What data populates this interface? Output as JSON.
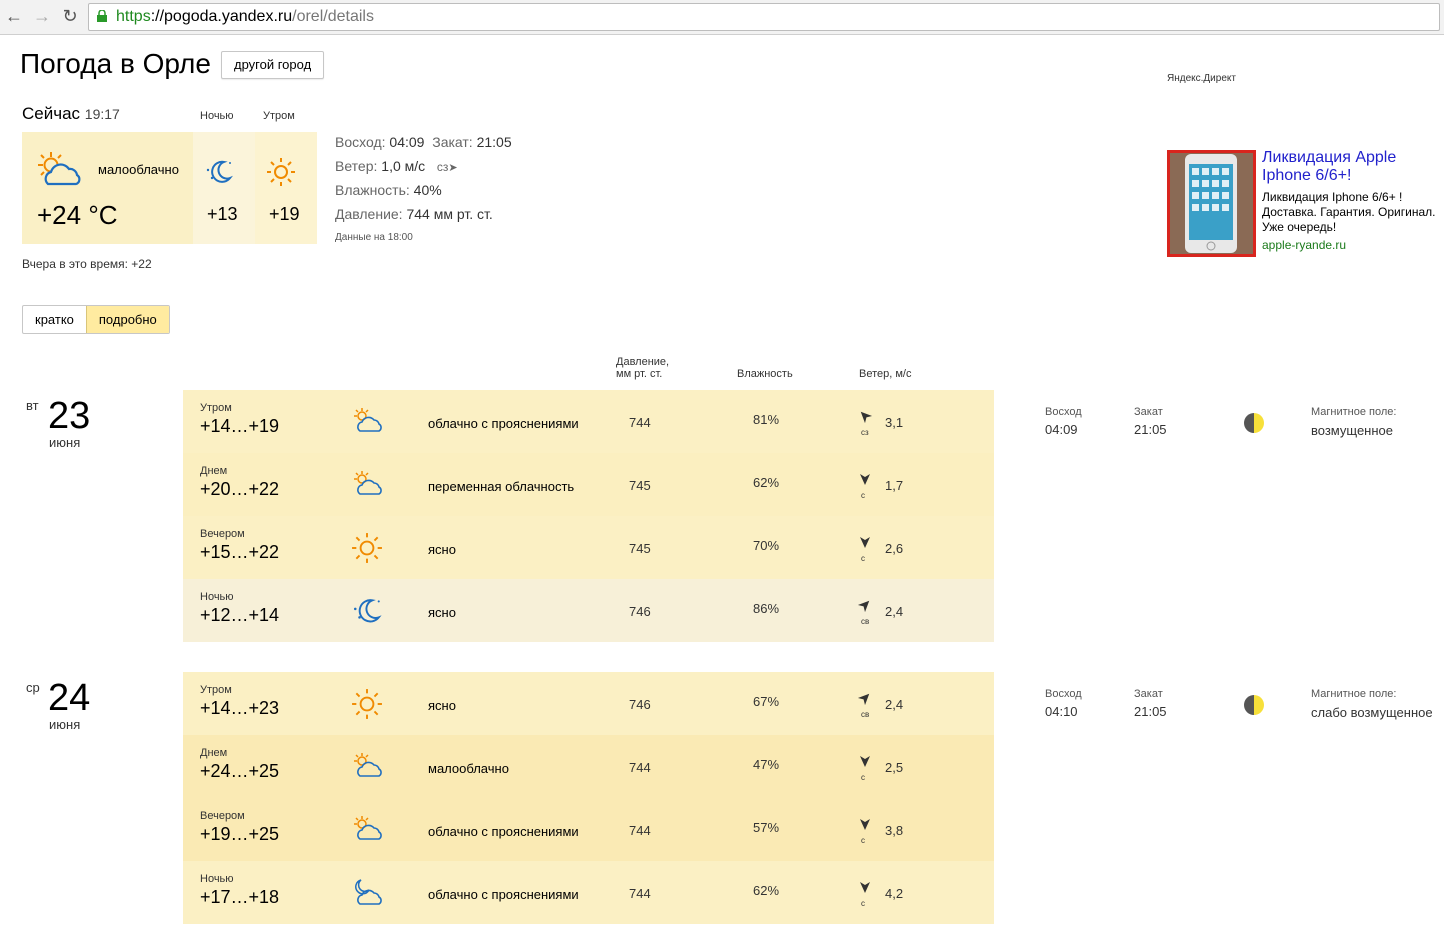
{
  "browser": {
    "url_scheme": "https",
    "url_host": "://pogoda.yandex.ru",
    "url_path": "/orel/details"
  },
  "header": {
    "title": "Погода в Орле",
    "other_city": "другой город"
  },
  "now": {
    "label": "Сейчас",
    "time": "19:17",
    "condition": "малооблачно",
    "temp": "+24 °C",
    "night_label": "Ночью",
    "night_temp": "+13",
    "morning_label": "Утром",
    "morning_temp": "+19",
    "yesterday": "Вчера в это время: +22"
  },
  "info": {
    "sunrise_label": "Восход:",
    "sunrise": "04:09",
    "sunset_label": "Закат:",
    "sunset": "21:05",
    "wind_label": "Ветер:",
    "wind": "1,0 м/с",
    "wind_dir": "сз",
    "humidity_label": "Влажность:",
    "humidity": "40%",
    "pressure_label": "Давление:",
    "pressure": "744 мм рт. ст.",
    "data_at": "Данные на 18:00"
  },
  "switch": {
    "brief": "кратко",
    "detailed": "подробно"
  },
  "columns": {
    "pressure1": "Давление,",
    "pressure2": "мм рт. ст.",
    "humidity": "Влажность",
    "wind": "Ветер, м/с"
  },
  "days": [
    {
      "dow": "вт",
      "num": "23",
      "month": "июня",
      "sunrise_label": "Восход",
      "sunrise": "04:09",
      "sunset_label": "Закат",
      "sunset": "21:05",
      "mag_label": "Магнитное поле:",
      "mag": "возмущенное",
      "rows": [
        {
          "part": "Утром",
          "temp": "+14…+19",
          "icon": "cloud-sun-icon",
          "cond": "облачно с прояснениями",
          "pres": "744",
          "hum": "81%",
          "wdir": "сз",
          "wind": "3,1",
          "bg": "#fbf0c4"
        },
        {
          "part": "Днем",
          "temp": "+20…+22",
          "icon": "cloud-sun-icon",
          "cond": "переменная облачность",
          "pres": "745",
          "hum": "62%",
          "wdir": "с",
          "wind": "1,7",
          "bg": "#fbefc0"
        },
        {
          "part": "Вечером",
          "temp": "+15…+22",
          "icon": "sun-icon",
          "cond": "ясно",
          "pres": "745",
          "hum": "70%",
          "wdir": "с",
          "wind": "2,6",
          "bg": "#fbf0c4"
        },
        {
          "part": "Ночью",
          "temp": "+12…+14",
          "icon": "moon-icon",
          "cond": "ясно",
          "pres": "746",
          "hum": "86%",
          "wdir": "св",
          "wind": "2,4",
          "bg": "#f7f0d8"
        }
      ]
    },
    {
      "dow": "ср",
      "num": "24",
      "month": "июня",
      "sunrise_label": "Восход",
      "sunrise": "04:10",
      "sunset_label": "Закат",
      "sunset": "21:05",
      "mag_label": "Магнитное поле:",
      "mag": "слабо возмущенное",
      "rows": [
        {
          "part": "Утром",
          "temp": "+14…+23",
          "icon": "sun-icon",
          "cond": "ясно",
          "pres": "746",
          "hum": "67%",
          "wdir": "св",
          "wind": "2,4",
          "bg": "#fbf0c4"
        },
        {
          "part": "Днем",
          "temp": "+24…+25",
          "icon": "cloud-sun-icon",
          "cond": "малооблачно",
          "pres": "744",
          "hum": "47%",
          "wdir": "с",
          "wind": "2,5",
          "bg": "#faeab4"
        },
        {
          "part": "Вечером",
          "temp": "+19…+25",
          "icon": "cloud-sun-icon",
          "cond": "облачно с прояснениями",
          "pres": "744",
          "hum": "57%",
          "wdir": "с",
          "wind": "3,8",
          "bg": "#faeab4"
        },
        {
          "part": "Ночью",
          "temp": "+17…+18",
          "icon": "cloud-moon-icon",
          "cond": "облачно с прояснениями",
          "pres": "744",
          "hum": "62%",
          "wdir": "с",
          "wind": "4,2",
          "bg": "#fbf0c4"
        }
      ]
    }
  ],
  "ad": {
    "label": "Яндекс.Директ",
    "title": "Ликвидация Apple Iphone 6/6+!",
    "text1": "Ликвидация Iphone 6/6+ !",
    "text2": "Доставка. Гарантия. Оригинал.",
    "text3": "Уже очередь!",
    "domain": "apple-ryande.ru"
  }
}
